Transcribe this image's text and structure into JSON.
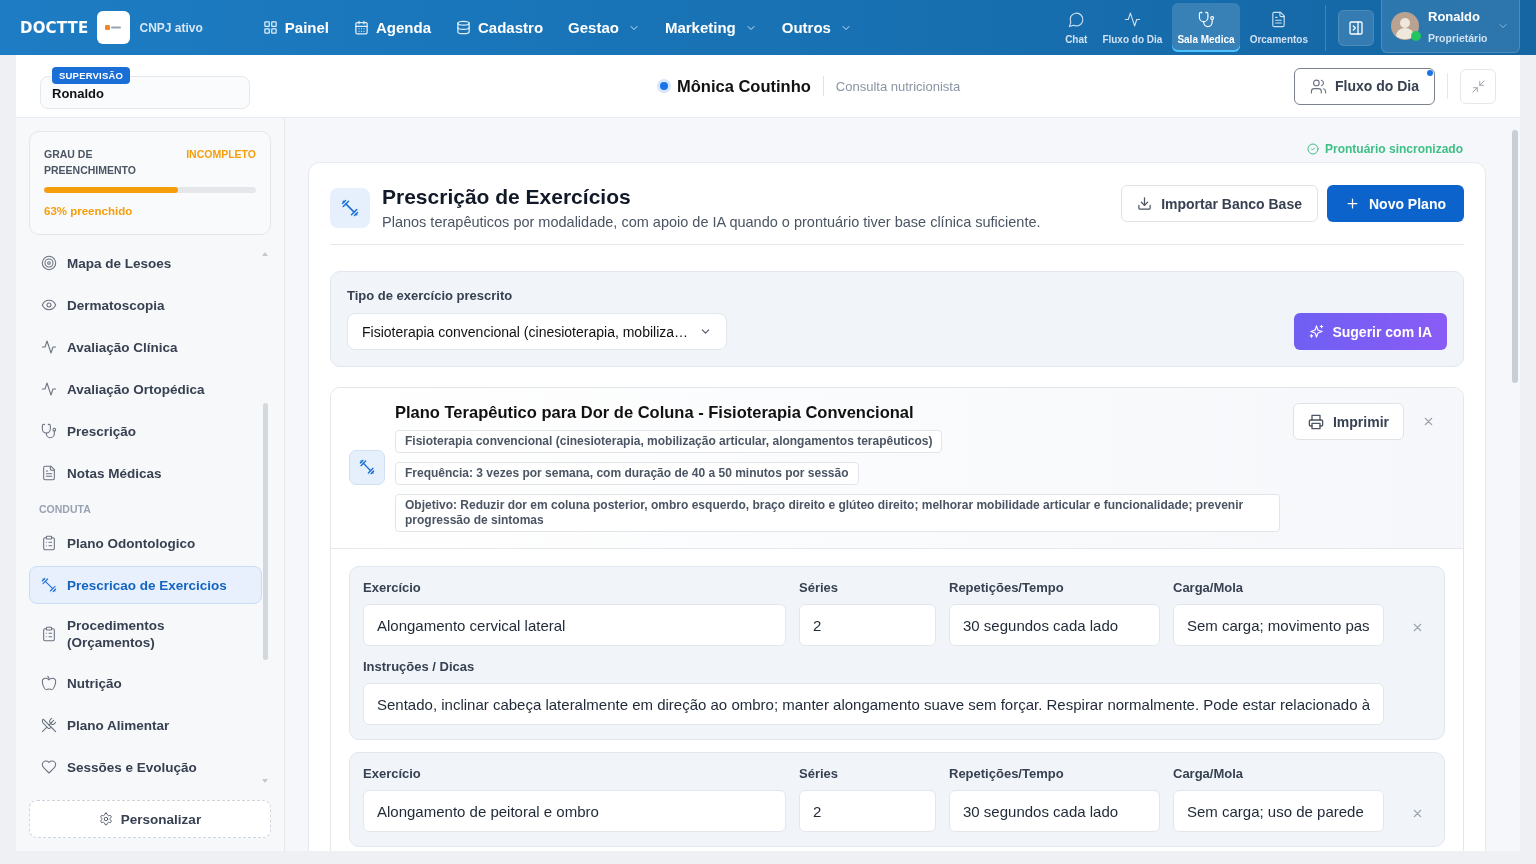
{
  "topbar": {
    "brand": "DOCTTE",
    "company_status": "CNPJ ativo",
    "nav": [
      {
        "label": "Painel",
        "dropdown": false
      },
      {
        "label": "Agenda",
        "dropdown": false
      },
      {
        "label": "Cadastro",
        "dropdown": false
      },
      {
        "label": "Gestao",
        "dropdown": true
      },
      {
        "label": "Marketing",
        "dropdown": true
      },
      {
        "label": "Outros",
        "dropdown": true
      }
    ],
    "modules": [
      {
        "label": "Chat",
        "selected": false
      },
      {
        "label": "Fluxo do Dia",
        "selected": false
      },
      {
        "label": "Sala Medica",
        "selected": true
      },
      {
        "label": "Orcamentos",
        "selected": false
      }
    ],
    "user": {
      "name": "Ronaldo",
      "role": "Proprietário",
      "online": true
    }
  },
  "header": {
    "supervision": {
      "badge": "SUPERVISÃO",
      "value": "Ronaldo"
    },
    "patient": {
      "name": "Mônica Coutinho",
      "appointment": "Consulta nutricionista"
    },
    "flow_button": {
      "label": "Fluxo do Dia",
      "notification": true
    }
  },
  "sidebar": {
    "completion": {
      "label": "GRAU DE PREENCHIMENTO",
      "status": "INCOMPLETO",
      "level": 0.63,
      "reading": "63% preenchido"
    },
    "groups": [
      {
        "items": [
          {
            "label": "Mapa de Lesoes",
            "selected": false
          },
          {
            "label": "Dermatoscopia",
            "selected": false
          },
          {
            "label": "Avaliação Clínica",
            "selected": false
          },
          {
            "label": "Avaliação Ortopédica",
            "selected": false
          },
          {
            "label": "Prescrição",
            "selected": false
          },
          {
            "label": "Notas Médicas",
            "selected": false
          }
        ]
      },
      {
        "title": "CONDUTA",
        "items": [
          {
            "label": "Plano Odontologico",
            "selected": false
          },
          {
            "label": "Prescricao de Exercicios",
            "selected": true
          },
          {
            "label": "Procedimentos (Orçamentos)",
            "selected": false
          },
          {
            "label": "Nutrição",
            "selected": false
          },
          {
            "label": "Plano Alimentar",
            "selected": false
          },
          {
            "label": "Sessões e Evolução",
            "selected": false
          }
        ]
      }
    ],
    "customize_button": "Personalizar"
  },
  "main": {
    "sync_status": "Prontuário sincronizado",
    "title": "Prescrição de Exercícios",
    "subtitle": "Planos terapêuticos por modalidade, com apoio de IA quando o prontuário tiver base clínica suficiente.",
    "import_button": "Importar Banco Base",
    "new_button": "Novo Plano",
    "type_field": {
      "label": "Tipo de exercício prescrito",
      "value": "Fisioterapia convencional (cinesioterapia, mobiliza…"
    },
    "suggest_button": "Sugerir com IA",
    "plan": {
      "title": "Plano Terapêutico para Dor de Coluna - Fisioterapia Convencional",
      "tags": [
        "Fisioterapia convencional (cinesioterapia, mobilização articular, alongamentos terapêuticos)",
        "Frequência: 3 vezes por semana, com duração de 40 a 50 minutos por sessão",
        "Objetivo: Reduzir dor em coluna posterior, ombro esquerdo, braço direito e glúteo direito; melhorar mobilidade articular e funcionalidade; prevenir progressão de sintomas"
      ],
      "print_button": "Imprimir",
      "exercises": [
        {
          "fields": [
            {
              "label": "Exercício",
              "value": "Alongamento cervical lateral"
            },
            {
              "label": "Séries",
              "value": "2"
            },
            {
              "label": "Repetições/Tempo",
              "value": "30 segundos cada lado"
            },
            {
              "label": "Carga/Mola",
              "value": "Sem carga; movimento pas"
            }
          ],
          "instructions": {
            "label": "Instruções / Dicas",
            "value": "Sentado, inclinar cabeça lateralmente em direção ao ombro; manter alongamento suave sem forçar. Respirar normalmente. Pode estar relacionado à"
          }
        },
        {
          "fields": [
            {
              "label": "Exercício",
              "value": "Alongamento de peitoral e ombro"
            },
            {
              "label": "Séries",
              "value": "2"
            },
            {
              "label": "Repetições/Tempo",
              "value": "30 segundos cada lado"
            },
            {
              "label": "Carga/Mola",
              "value": "Sem carga; uso de parede"
            }
          ]
        }
      ]
    }
  }
}
